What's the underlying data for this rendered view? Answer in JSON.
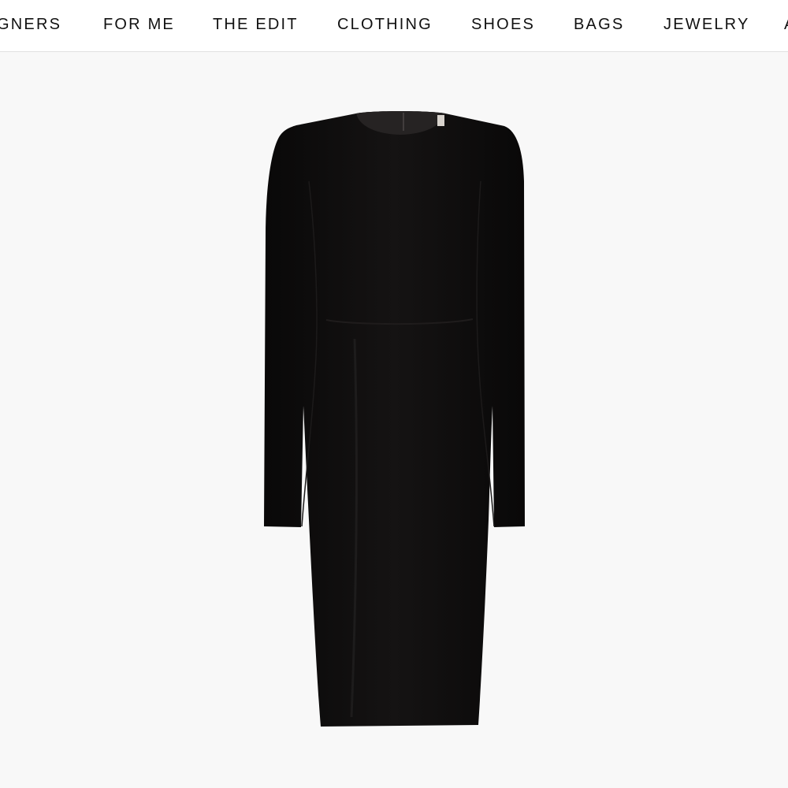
{
  "nav": {
    "items": [
      {
        "label": "GNERS",
        "name": "nav-item-designers"
      },
      {
        "label": "FOR ME",
        "name": "nav-item-for-me"
      },
      {
        "label": "THE EDIT",
        "name": "nav-item-the-edit"
      },
      {
        "label": "CLOTHING",
        "name": "nav-item-clothing"
      },
      {
        "label": "SHOES",
        "name": "nav-item-shoes"
      },
      {
        "label": "BAGS",
        "name": "nav-item-bags"
      },
      {
        "label": "JEWELRY",
        "name": "nav-item-jewelry"
      },
      {
        "label": "A",
        "name": "nav-item-accessories"
      }
    ]
  },
  "product": {
    "image_icon": "black-long-sleeve-midi-dress",
    "dress_color": "#0f0d0d",
    "background_color": "#f8f8f8"
  }
}
